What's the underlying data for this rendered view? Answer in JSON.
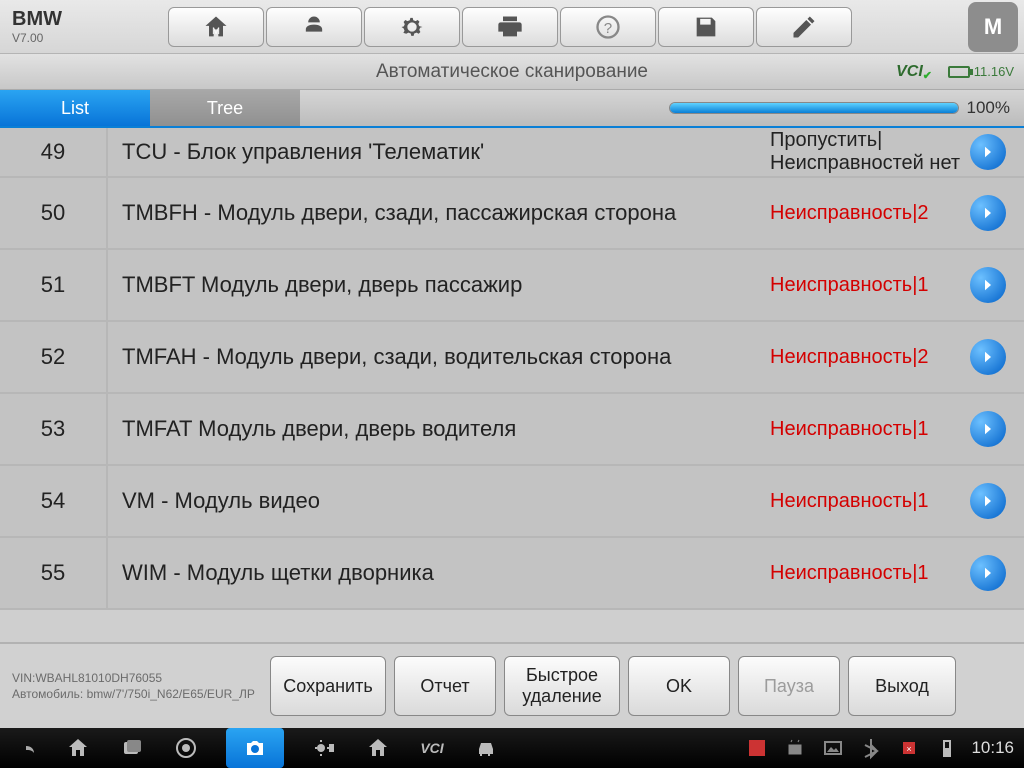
{
  "brand": {
    "name": "BMW",
    "version": "V7.00"
  },
  "subheader": {
    "title": "Автоматическое сканирование",
    "vci_label": "VCI",
    "battery": "11.16V"
  },
  "tabs": {
    "list": "List",
    "tree": "Tree"
  },
  "progress": {
    "percent_label": "100%",
    "percent_value": 100
  },
  "rows": [
    {
      "num": "49",
      "name": "TCU - Блок управления 'Телематик'",
      "status": "Пропустить|Неисправностей нет",
      "fault": false
    },
    {
      "num": "50",
      "name": "TMBFH - Модуль двери, сзади, пассажирская сторона",
      "status": "Неисправность|2",
      "fault": true
    },
    {
      "num": "51",
      "name": "TMBFT Модуль двери, дверь пассажир",
      "status": "Неисправность|1",
      "fault": true
    },
    {
      "num": "52",
      "name": "TMFAH - Модуль двери, сзади, водительская сторона",
      "status": "Неисправность|2",
      "fault": true
    },
    {
      "num": "53",
      "name": "TMFAT Модуль двери, дверь водителя",
      "status": "Неисправность|1",
      "fault": true
    },
    {
      "num": "54",
      "name": "VM - Модуль видео",
      "status": "Неисправность|1",
      "fault": true
    },
    {
      "num": "55",
      "name": "WIM - Модуль щетки дворника",
      "status": "Неисправность|1",
      "fault": true
    }
  ],
  "vehicle": {
    "vin": "VIN:WBAHL81010DH76055",
    "desc": "Автомобиль: bmw/7'/750i_N62/E65/EUR_ЛР"
  },
  "footer": {
    "save": "Сохранить",
    "report": "Отчет",
    "quick_erase": "Быстрое удаление",
    "ok": "OK",
    "pause": "Пауза",
    "exit": "Выход"
  },
  "statusbar": {
    "clock": "10:16"
  },
  "m_button": "M"
}
